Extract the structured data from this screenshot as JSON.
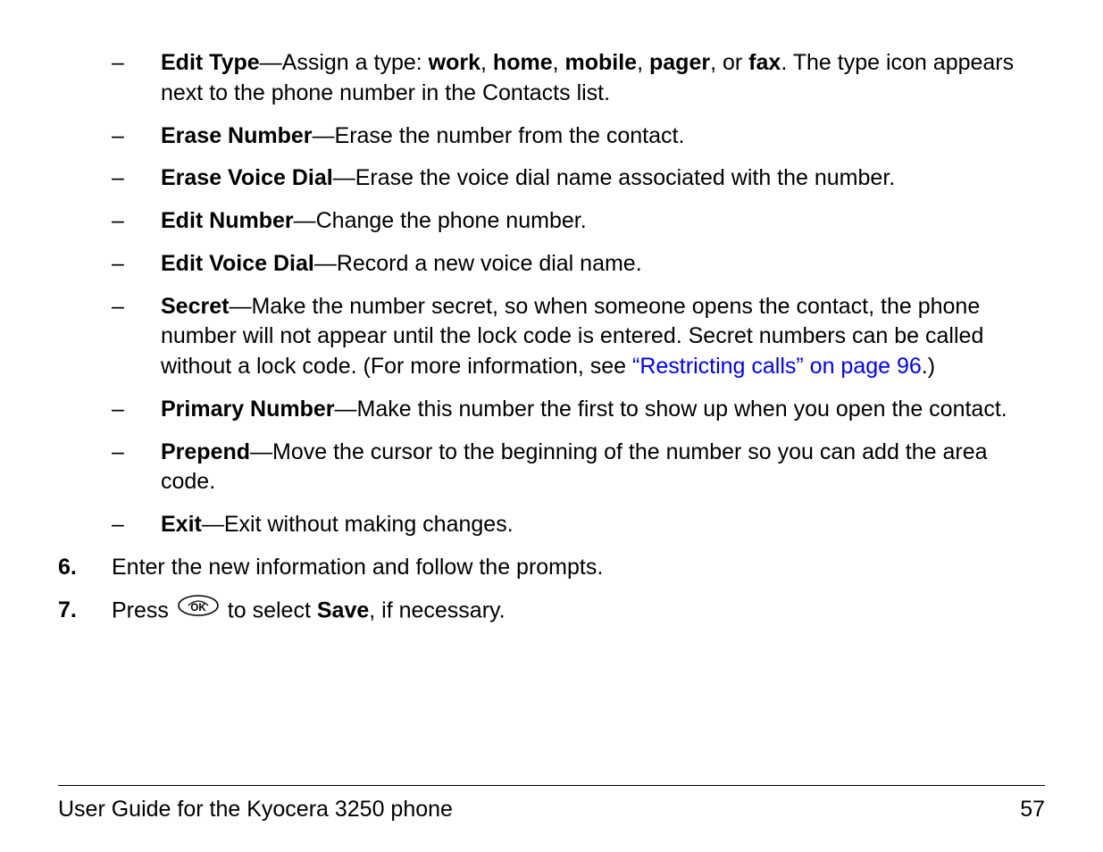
{
  "items": [
    {
      "term": "Edit Type",
      "desc_before": "—Assign a type: ",
      "inline_bold": [
        "work",
        "home",
        "mobile",
        "pager",
        "fax"
      ],
      "inline_sep": ", ",
      "inline_last_sep": ", or ",
      "desc_after": ". The type icon appears next to the phone number in the Contacts list."
    },
    {
      "term": "Erase Number",
      "desc": "—Erase the number from the contact."
    },
    {
      "term": "Erase Voice Dial",
      "desc": "—Erase the voice dial name associated with the number."
    },
    {
      "term": "Edit Number",
      "desc": "—Change the phone number."
    },
    {
      "term": "Edit Voice Dial",
      "desc": "—Record a new voice dial name."
    },
    {
      "term": "Secret",
      "desc_before": "—Make the number secret, so when someone opens the contact, the phone number will not appear until the lock code is entered. Secret numbers can be called without a lock code. (For more information, see ",
      "link": "“Restricting calls” on page 96",
      "desc_after": ".)"
    },
    {
      "term": "Primary Number",
      "desc": "—Make this number the first to show up when you open the contact."
    },
    {
      "term": "Prepend",
      "desc": "—Move the cursor to the beginning of the number so you can add the area code."
    },
    {
      "term": "Exit",
      "desc": "—Exit without making changes."
    }
  ],
  "steps": {
    "s6": {
      "num": "6.",
      "text": "Enter the new information and follow the prompts."
    },
    "s7": {
      "num": "7.",
      "before": "Press ",
      "icon": "OK",
      "after_before_bold": " to select ",
      "bold": "Save",
      "after": ", if necessary."
    }
  },
  "footer": {
    "left": "User Guide for the Kyocera 3250 phone",
    "right": "57"
  }
}
